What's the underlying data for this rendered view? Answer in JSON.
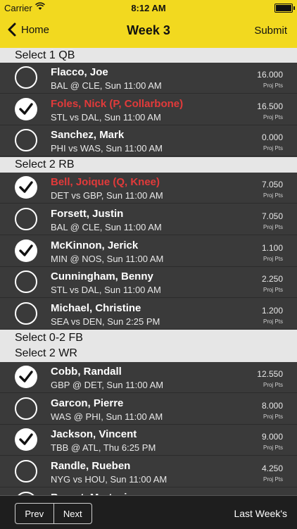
{
  "status": {
    "carrier": "Carrier",
    "time": "8:12 AM"
  },
  "nav": {
    "back_label": "Home",
    "title": "Week 3",
    "submit_label": "Submit"
  },
  "sections": [
    {
      "label": "Select 1 QB"
    },
    {
      "label": "Select 2 RB"
    },
    {
      "label": "Select 0-2 FB"
    },
    {
      "label": "Select 2 WR"
    }
  ],
  "players": [
    {
      "name": "Flacco, Joe",
      "game": "BAL @ CLE, Sun 11:00 AM",
      "pts": "16.000",
      "checked": false,
      "injured": false
    },
    {
      "name": "Foles, Nick (P, Collarbone)",
      "game": "STL vs DAL, Sun 11:00 AM",
      "pts": "16.500",
      "checked": true,
      "injured": true
    },
    {
      "name": "Sanchez, Mark",
      "game": "PHI vs WAS, Sun 11:00 AM",
      "pts": "0.000",
      "checked": false,
      "injured": false
    },
    {
      "name": "Bell, Joique (Q, Knee)",
      "game": "DET vs GBP, Sun 11:00 AM",
      "pts": "7.050",
      "checked": true,
      "injured": true
    },
    {
      "name": "Forsett, Justin",
      "game": "BAL @ CLE, Sun 11:00 AM",
      "pts": "7.050",
      "checked": false,
      "injured": false
    },
    {
      "name": "McKinnon, Jerick",
      "game": "MIN @ NOS, Sun 11:00 AM",
      "pts": "1.100",
      "checked": true,
      "injured": false
    },
    {
      "name": "Cunningham, Benny",
      "game": "STL vs DAL, Sun 11:00 AM",
      "pts": "2.250",
      "checked": false,
      "injured": false
    },
    {
      "name": "Michael, Christine",
      "game": "SEA vs DEN, Sun 2:25 PM",
      "pts": "1.200",
      "checked": false,
      "injured": false
    },
    {
      "name": "Cobb, Randall",
      "game": "GBP @ DET, Sun 11:00 AM",
      "pts": "12.550",
      "checked": true,
      "injured": false
    },
    {
      "name": "Garcon, Pierre",
      "game": "WAS @ PHI, Sun 11:00 AM",
      "pts": "8.000",
      "checked": false,
      "injured": false
    },
    {
      "name": "Jackson, Vincent",
      "game": "TBB @ ATL, Thu 6:25 PM",
      "pts": "9.000",
      "checked": true,
      "injured": false
    },
    {
      "name": "Randle, Rueben",
      "game": "NYG vs HOU, Sun 11:00 AM",
      "pts": "4.250",
      "checked": false,
      "injured": false
    },
    {
      "name": "Bryant, Martavis",
      "game": "",
      "pts": "",
      "checked": false,
      "injured": false
    }
  ],
  "proj_label": "Proj Pts",
  "bottom": {
    "prev_label": "Prev",
    "next_label": "Next",
    "last_week_label": "Last Week's"
  },
  "colors": {
    "accent": "#f2d91f",
    "injured": "#e23a3a",
    "row_bg": "#3a3a3a",
    "section_bg": "#e6e6e6"
  }
}
